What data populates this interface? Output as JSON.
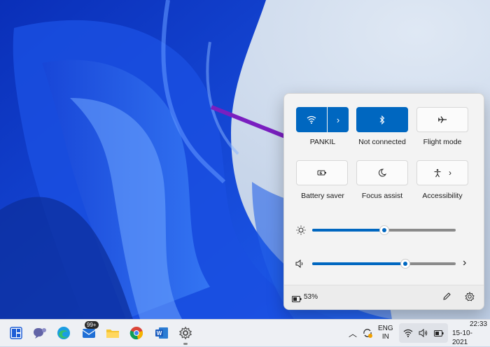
{
  "quick_settings": {
    "wifi": {
      "label": "PANKIL"
    },
    "bluetooth": {
      "label": "Not connected"
    },
    "flight": {
      "label": "Flight mode"
    },
    "battery_saver": {
      "label": "Battery saver"
    },
    "focus_assist": {
      "label": "Focus assist"
    },
    "accessibility": {
      "label": "Accessibility"
    },
    "brightness_level": 0.5,
    "volume_level": 0.65,
    "battery_percent": "53%"
  },
  "taskbar": {
    "mail_badge": "99+",
    "language": "ENG",
    "region": "IN",
    "time": "22:33",
    "date": "15-10-2021"
  },
  "colors": {
    "accent": "#0067c0",
    "arrow": "#7a1fc0"
  },
  "icons": [
    "wifi-icon",
    "bluetooth-icon",
    "airplane-icon",
    "battery-saver-icon",
    "moon-icon",
    "accessibility-icon",
    "brightness-icon",
    "volume-icon",
    "chevron-right-icon",
    "pencil-icon",
    "gear-icon",
    "battery-icon"
  ]
}
